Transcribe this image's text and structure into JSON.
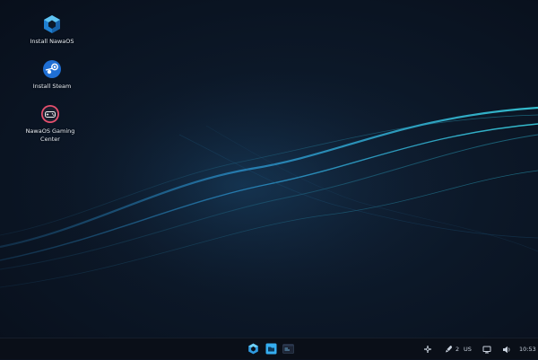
{
  "desktop": {
    "icons": [
      {
        "label": "Install NawaOS",
        "icon": "nawaos-hexagon-icon"
      },
      {
        "label": "Install Steam",
        "icon": "steam-icon"
      },
      {
        "label": "NawaOS Gaming\nCenter",
        "icon": "gamepad-icon"
      }
    ]
  },
  "taskbar": {
    "apps": [
      {
        "icon": "nawaos-launcher-icon"
      },
      {
        "icon": "file-manager-icon"
      },
      {
        "icon": "terminal-icon"
      }
    ],
    "tray": {
      "gamepad_icon": "gamepad-icon",
      "updates_count": "2",
      "keyboard_layout": "US",
      "network_icon": "ethernet-icon",
      "volume_icon": "volume-icon",
      "clock": "10:53"
    }
  },
  "colors": {
    "accent": "#2f9be0",
    "steam": "#1f6fd4",
    "gaming_center": "#e8506e",
    "taskbar": "#0a0f18"
  }
}
